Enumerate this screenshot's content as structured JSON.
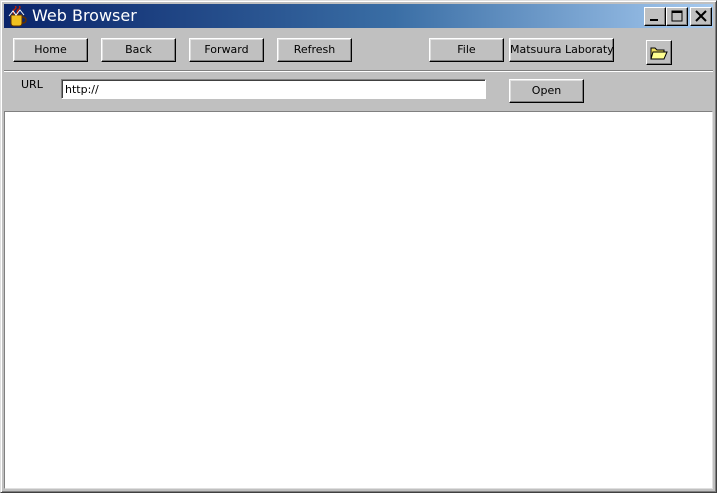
{
  "window": {
    "title": "Web Browser",
    "icons": {
      "app": "java-coffee-cup-icon",
      "minimize": "minimize-icon",
      "maximize": "maximize-icon",
      "close": "close-icon"
    }
  },
  "toolbar": {
    "home_label": "Home",
    "back_label": "Back",
    "forward_label": "Forward",
    "refresh_label": "Refresh",
    "file_label": "File",
    "lab_label": "Matsuura Laboraty",
    "folder_icon": "open-folder-icon"
  },
  "address": {
    "label": "URL",
    "value": "http://",
    "open_label": "Open"
  },
  "colors": {
    "titlebar_start": "#0a246a",
    "titlebar_end": "#a6caf0",
    "face": "#c0c0c0",
    "content_bg": "#ffffff"
  }
}
